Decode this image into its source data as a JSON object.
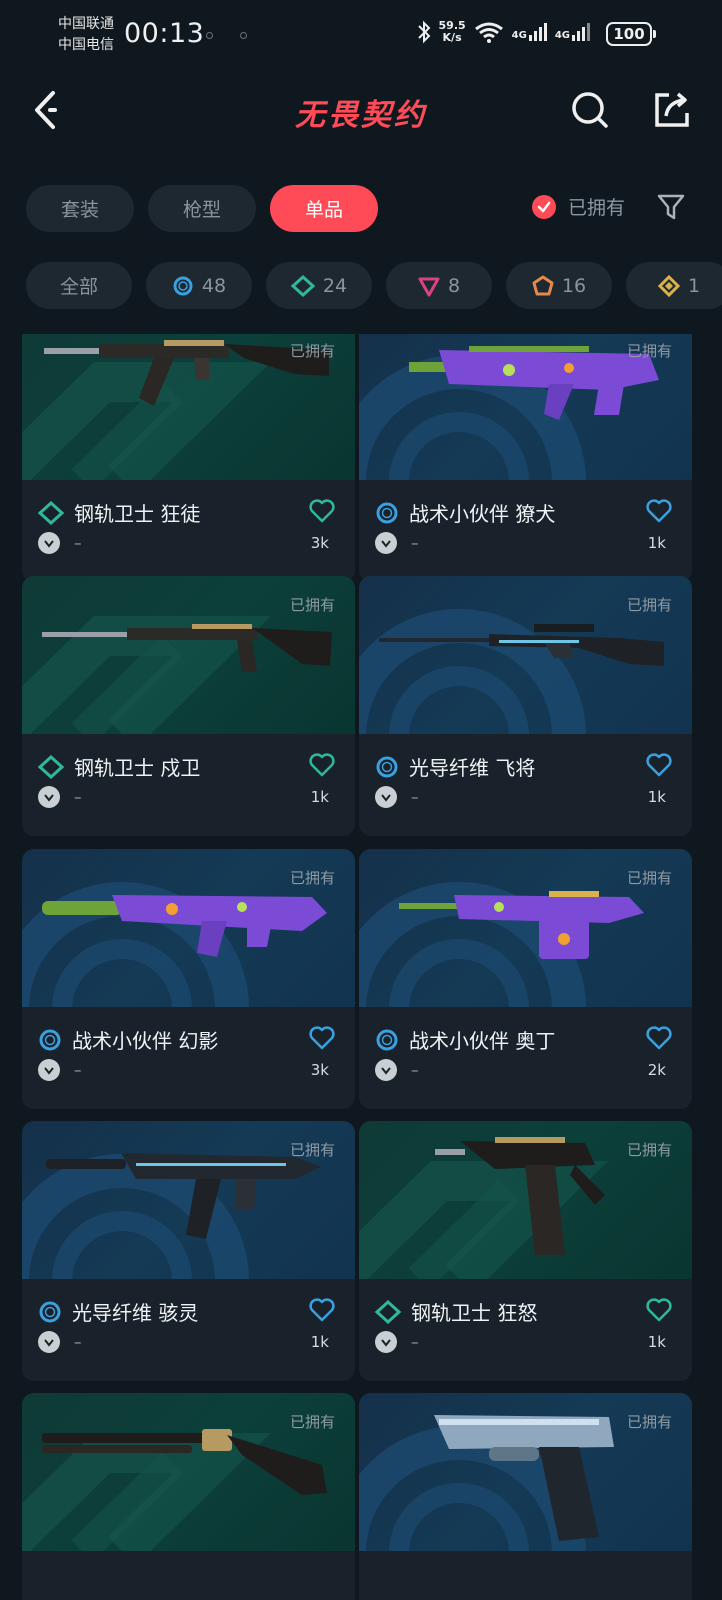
{
  "status_bar": {
    "carrier_1": "中国联通",
    "carrier_2": "中国电信",
    "time": "00:13",
    "speed_value": "59.5",
    "speed_unit": "K/s",
    "net_1": "4G",
    "net_2": "4G",
    "battery": "100"
  },
  "header": {
    "title": "无畏契约"
  },
  "type_tabs": [
    {
      "label": "套装",
      "active": false
    },
    {
      "label": "枪型",
      "active": false
    },
    {
      "label": "单品",
      "active": true
    }
  ],
  "owned_filter": {
    "label": "已拥有",
    "checked": true
  },
  "rarity_chips": [
    {
      "label": "全部",
      "icon": "all"
    },
    {
      "label": "48",
      "icon": "blue-ring-icon",
      "color": "#3aa0e0"
    },
    {
      "label": "24",
      "icon": "green-diamond-icon",
      "color": "#2fb89a"
    },
    {
      "label": "8",
      "icon": "pink-triangle-icon",
      "color": "#d8457e"
    },
    {
      "label": "16",
      "icon": "orange-pentagon-icon",
      "color": "#e58a4a"
    },
    {
      "label": "1",
      "icon": "gold-diamond-icon",
      "color": "#d9b34a"
    }
  ],
  "colors": {
    "accent": "#ff4a57",
    "blue_tier": "#3aa0e0",
    "green_tier": "#2fb89a"
  },
  "cards": [
    {
      "name": "钢轨卫士 狂徒",
      "tier": "green",
      "owned_label": "已拥有",
      "meta": "–",
      "count": "3k"
    },
    {
      "name": "战术小伙伴 獠犬",
      "tier": "blue",
      "owned_label": "已拥有",
      "meta": "–",
      "count": "1k"
    },
    {
      "name": "钢轨卫士 戍卫",
      "tier": "green",
      "owned_label": "已拥有",
      "meta": "–",
      "count": "1k"
    },
    {
      "name": "光导纤维 飞将",
      "tier": "blue",
      "owned_label": "已拥有",
      "meta": "–",
      "count": "1k"
    },
    {
      "name": "战术小伙伴 幻影",
      "tier": "blue",
      "owned_label": "已拥有",
      "meta": "–",
      "count": "3k"
    },
    {
      "name": "战术小伙伴 奥丁",
      "tier": "blue",
      "owned_label": "已拥有",
      "meta": "–",
      "count": "2k"
    },
    {
      "name": "光导纤维 骇灵",
      "tier": "blue",
      "owned_label": "已拥有",
      "meta": "–",
      "count": "1k"
    },
    {
      "name": "钢轨卫士 狂怒",
      "tier": "green",
      "owned_label": "已拥有",
      "meta": "–",
      "count": "1k"
    },
    {
      "name": "",
      "tier": "green",
      "owned_label": "已拥有",
      "meta": "",
      "count": ""
    },
    {
      "name": "",
      "tier": "blue",
      "owned_label": "已拥有",
      "meta": "",
      "count": ""
    }
  ]
}
